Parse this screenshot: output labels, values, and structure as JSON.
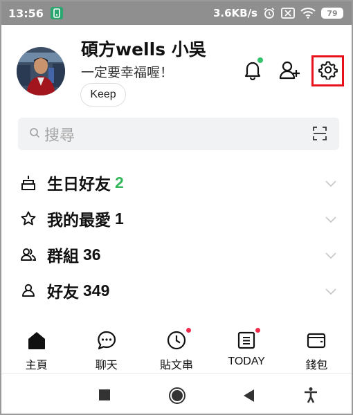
{
  "status_bar": {
    "time": "13:56",
    "speed": "3.6KB/s",
    "battery": "79",
    "icons": [
      "app-notification-icon",
      "alarm-icon",
      "sim-off-icon",
      "wifi-icon",
      "battery-icon"
    ]
  },
  "profile": {
    "name": "碩方wells 小吳",
    "status_message": "一定要幸福喔！",
    "keep_label": "Keep",
    "bell_badge_color": "#33c56b",
    "settings_highlight_color": "#e8101a"
  },
  "search": {
    "placeholder": "搜尋"
  },
  "list": [
    {
      "icon": "cake-icon",
      "label": "生日好友",
      "count": "2",
      "count_color": "#33b55a"
    },
    {
      "icon": "star-icon",
      "label": "我的最愛",
      "count": "1"
    },
    {
      "icon": "group-icon",
      "label": "群組",
      "count": "36"
    },
    {
      "icon": "person-icon",
      "label": "好友",
      "count": "349"
    }
  ],
  "tabs": [
    {
      "icon": "home-icon",
      "label": "主頁",
      "active": true
    },
    {
      "icon": "chat-icon",
      "label": "聊天"
    },
    {
      "icon": "timeline-icon",
      "label": "貼文串",
      "badge": true
    },
    {
      "icon": "today-icon",
      "label": "TODAY",
      "badge": true
    },
    {
      "icon": "wallet-icon",
      "label": "錢包"
    }
  ],
  "nav_bar": {
    "icons": [
      "recent-apps-icon",
      "home-circle-icon",
      "back-icon",
      "accessibility-icon"
    ]
  }
}
